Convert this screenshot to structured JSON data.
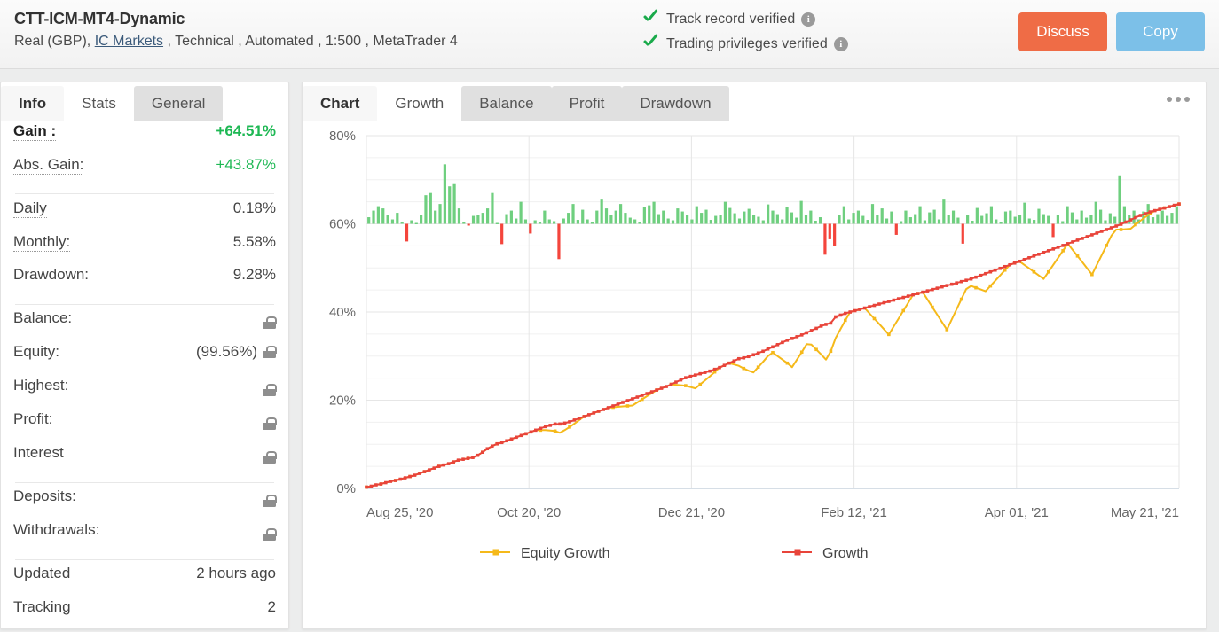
{
  "header": {
    "account_title": "CTT-ICM-MT4-Dynamic",
    "account_subtitle_pre": "Real (GBP), ",
    "broker_link": "IC Markets",
    "account_subtitle_post": " , Technical , Automated , 1:500 , MetaTrader 4",
    "verifications": [
      {
        "label": "Track record verified",
        "icon": "check-icon",
        "info": "i"
      },
      {
        "label": "Trading privileges verified",
        "icon": "check-icon",
        "info": "i"
      }
    ],
    "buttons": {
      "discuss": "Discuss",
      "copy": "Copy"
    },
    "colors": {
      "discuss_bg": "#ef6c46",
      "copy_bg": "#7cc0e8",
      "verified_green": "#1aaa4b"
    }
  },
  "sidebar": {
    "tabs": [
      {
        "label": "Info",
        "state": "light"
      },
      {
        "label": "Stats",
        "state": "active"
      },
      {
        "label": "General",
        "state": "grey"
      }
    ],
    "groups": [
      {
        "rows": [
          {
            "label": "Gain :",
            "value": "+64.51%",
            "style": "green-bold",
            "dotted": true,
            "bold": true
          },
          {
            "label": "Abs. Gain:",
            "value": "+43.87%",
            "style": "green",
            "dotted": true
          }
        ]
      },
      {
        "rows": [
          {
            "label": "Daily",
            "value": "0.18%",
            "dotted": true
          },
          {
            "label": "Monthly:",
            "value": "5.58%",
            "dotted": true
          },
          {
            "label": "Drawdown:",
            "value": "9.28%"
          }
        ]
      },
      {
        "rows": [
          {
            "label": "Balance:",
            "value": "",
            "lock": true
          },
          {
            "label": "Equity:",
            "value": "(99.56%)",
            "lock": true
          },
          {
            "label": "Highest:",
            "value": "",
            "lock": true
          },
          {
            "label": "Profit:",
            "value": "",
            "lock": true
          },
          {
            "label": "Interest",
            "value": "",
            "lock": true
          }
        ]
      },
      {
        "rows": [
          {
            "label": "Deposits:",
            "value": "",
            "lock": true
          },
          {
            "label": "Withdrawals:",
            "value": "",
            "lock": true
          }
        ]
      },
      {
        "rows": [
          {
            "label": "Updated",
            "value": "2 hours ago"
          },
          {
            "label": "Tracking",
            "value": "2"
          }
        ]
      }
    ]
  },
  "chart_panel": {
    "tabs": [
      {
        "label": "Chart",
        "state": "light"
      },
      {
        "label": "Growth",
        "state": "active"
      },
      {
        "label": "Balance",
        "state": "grey"
      },
      {
        "label": "Profit",
        "state": "grey"
      },
      {
        "label": "Drawdown",
        "state": "grey"
      }
    ],
    "menu_icon": "ellipsis-icon"
  },
  "chart_data": {
    "type": "line",
    "title": "Growth",
    "xlabel": "",
    "ylabel": "",
    "ylim": [
      0,
      80
    ],
    "yticks": [
      0,
      20,
      40,
      60,
      80
    ],
    "ytick_labels": [
      "0%",
      "20%",
      "40%",
      "60%",
      "80%"
    ],
    "minor_gridline_step": 5,
    "grid": true,
    "legend_position": "bottom",
    "xtick_labels": [
      "Aug 25, '20",
      "Oct 20, '20",
      "Dec 21, '20",
      "Feb 12, '21",
      "Apr 01, '21",
      "May 21, '21"
    ],
    "xtick_positions": [
      0,
      0.2,
      0.4,
      0.6,
      0.8,
      1.0
    ],
    "series": [
      {
        "name": "Growth",
        "color": "#e8443a",
        "marker": "square",
        "values": [
          0.3,
          0.5,
          0.8,
          1.0,
          1.3,
          1.6,
          1.8,
          2.1,
          2.4,
          2.7,
          3.0,
          3.4,
          3.8,
          4.2,
          4.6,
          5.0,
          5.3,
          5.6,
          6.0,
          6.4,
          6.6,
          6.8,
          7.0,
          7.5,
          8.2,
          9.0,
          9.6,
          10.1,
          10.4,
          10.8,
          11.2,
          11.6,
          12.0,
          12.4,
          12.8,
          13.2,
          13.6,
          14.0,
          14.3,
          14.6,
          14.6,
          14.8,
          15.1,
          15.5,
          15.9,
          16.3,
          16.7,
          17.1,
          17.5,
          17.9,
          18.3,
          18.7,
          19.1,
          19.5,
          19.9,
          20.3,
          20.7,
          21.1,
          21.5,
          21.9,
          22.3,
          22.7,
          23.1,
          23.6,
          24.1,
          24.6,
          25.1,
          25.4,
          25.7,
          26.0,
          26.3,
          26.6,
          27.0,
          27.4,
          27.9,
          28.4,
          28.9,
          29.4,
          29.6,
          29.9,
          30.3,
          30.7,
          31.1,
          31.6,
          32.1,
          32.6,
          33.1,
          33.6,
          34.0,
          34.4,
          34.8,
          35.3,
          35.8,
          36.3,
          36.8,
          37.2,
          37.5,
          38.9,
          39.3,
          39.7,
          40.0,
          40.3,
          40.6,
          40.9,
          41.2,
          41.5,
          41.8,
          42.1,
          42.4,
          42.7,
          43.0,
          43.3,
          43.6,
          43.9,
          44.2,
          44.5,
          44.8,
          45.1,
          45.4,
          45.7,
          46.0,
          46.3,
          46.6,
          46.9,
          47.2,
          47.5,
          47.9,
          48.3,
          48.7,
          49.1,
          49.5,
          49.9,
          50.3,
          50.7,
          51.1,
          51.5,
          51.9,
          52.3,
          52.7,
          53.1,
          53.5,
          53.9,
          54.3,
          54.7,
          55.1,
          55.5,
          55.9,
          56.3,
          56.7,
          57.1,
          57.5,
          57.9,
          58.3,
          58.7,
          59.1,
          59.5,
          59.9,
          60.4,
          60.9,
          61.4,
          61.9,
          62.3,
          62.7,
          63.0,
          63.3,
          63.6,
          63.9,
          64.2,
          64.5
        ],
        "description": "Cumulative growth line, rises from 0% to +64.51%"
      },
      {
        "name": "Equity Growth",
        "color": "#f5b91a",
        "marker": "square",
        "description": "Equity curve tracks Growth but dips below it with sawtooth drawdowns (floating losses)",
        "dips": [
          {
            "index": 40,
            "depth": 2.0
          },
          {
            "index": 55,
            "depth": 1.5
          },
          {
            "index": 68,
            "depth": 3.0
          },
          {
            "index": 80,
            "depth": 4.0
          },
          {
            "index": 88,
            "depth": 6.5
          },
          {
            "index": 95,
            "depth": 8.0
          },
          {
            "index": 108,
            "depth": 7.5
          },
          {
            "index": 120,
            "depth": 10.0
          },
          {
            "index": 128,
            "depth": 4.0
          },
          {
            "index": 140,
            "depth": 6.0
          },
          {
            "index": 150,
            "depth": 9.0
          },
          {
            "index": 158,
            "depth": 2.0
          }
        ]
      }
    ],
    "bars": {
      "baseline_value": 60,
      "positive_color": "#6fcf7f",
      "negative_color": "#f4453c",
      "description": "Daily profit/loss bars drawn around a 60% baseline; green above, red below",
      "values": [
        1.5,
        3.0,
        4.0,
        3.5,
        2.0,
        1.0,
        2.5,
        0.3,
        -4.0,
        0.8,
        0.2,
        2.0,
        6.5,
        7.0,
        3.0,
        4.5,
        13.5,
        8.5,
        9.0,
        3.5,
        0.4,
        -0.4,
        1.8,
        2.0,
        2.5,
        3.5,
        7.0,
        0.2,
        -4.6,
        2.2,
        3.0,
        1.2,
        5.0,
        1.0,
        -2.2,
        0.8,
        0.4,
        3.0,
        1.0,
        0.6,
        -8.0,
        1.2,
        2.5,
        4.5,
        0.9,
        3.2,
        1.0,
        0.4,
        3.0,
        5.5,
        3.5,
        2.0,
        3.0,
        4.5,
        2.5,
        1.4,
        1.0,
        0.5,
        3.8,
        4.2,
        5.0,
        2.2,
        3.0,
        1.2,
        0.8,
        3.5,
        2.8,
        2.0,
        1.0,
        4.0,
        2.5,
        3.2,
        0.9,
        1.8,
        2.0,
        5.0,
        3.6,
        2.4,
        1.2,
        2.8,
        3.4,
        2.0,
        1.6,
        0.8,
        4.4,
        3.0,
        2.2,
        1.0,
        3.8,
        2.6,
        1.4,
        5.2,
        2.0,
        3.0,
        0.7,
        1.5,
        -7.0,
        -3.5,
        -5.0,
        2.0,
        4.0,
        1.0,
        2.5,
        3.0,
        1.8,
        0.9,
        4.5,
        2.0,
        3.5,
        1.2,
        2.8,
        -2.5,
        0.6,
        3.0,
        1.5,
        2.2,
        4.0,
        0.8,
        2.6,
        3.2,
        1.0,
        5.5,
        2.0,
        3.0,
        1.4,
        -4.5,
        2.0,
        0.7,
        3.6,
        1.8,
        2.4,
        4.0,
        1.0,
        0.5,
        2.8,
        3.0,
        1.6,
        2.0,
        4.8,
        1.2,
        0.9,
        3.4,
        2.2,
        1.8,
        -3.0,
        2.0,
        0.6,
        4.0,
        2.6,
        1.0,
        3.0,
        1.4,
        2.0,
        5.0,
        3.2,
        0.8,
        2.4,
        1.6,
        11.0,
        4.0,
        2.0,
        3.0,
        1.0,
        2.8,
        4.5,
        1.5,
        2.2,
        3.0,
        1.8,
        2.5,
        4.0
      ]
    },
    "legend": [
      {
        "label": "Equity Growth",
        "color": "#f5b91a"
      },
      {
        "label": "Growth",
        "color": "#e8443a"
      }
    ]
  }
}
